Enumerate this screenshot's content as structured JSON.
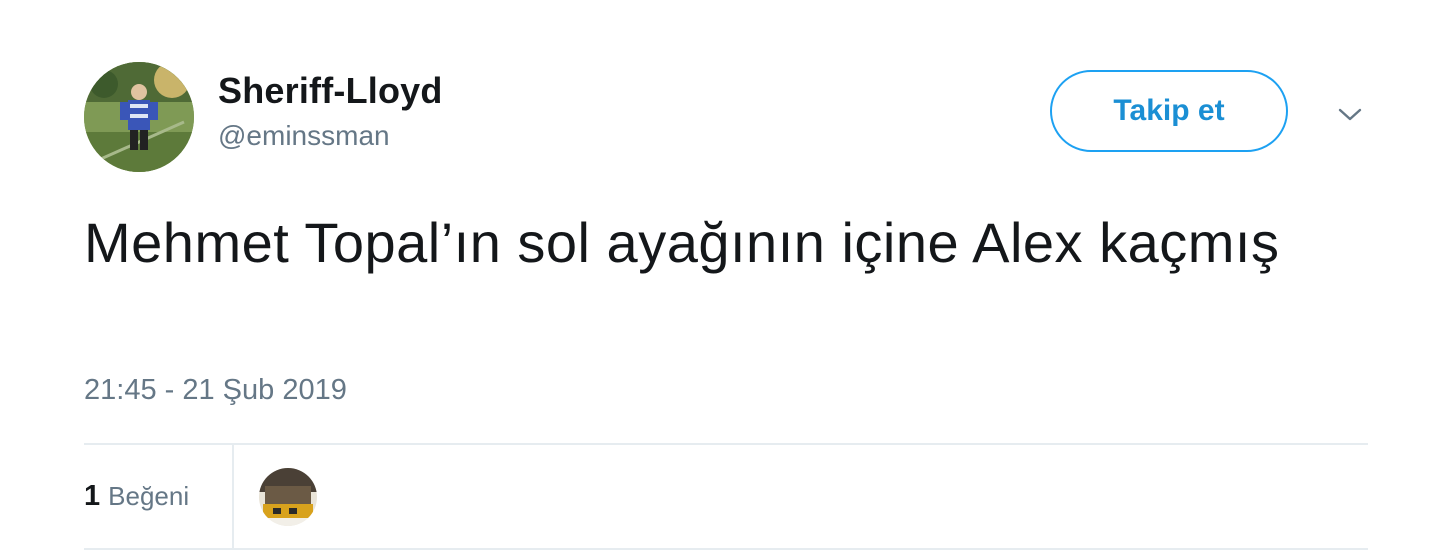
{
  "tweet": {
    "display_name": "Sheriff-Lloyd",
    "username": "@eminssman",
    "follow_label": "Takip et",
    "text": "Mehmet Topal’ın sol ayağının içine Alex kaçmış",
    "timestamp": "21:45 - 21 Şub 2019",
    "likes": {
      "count": "1",
      "label": "Beğeni"
    }
  },
  "icons": {
    "caret": "chevron-down-icon",
    "avatar": "user-avatar",
    "liker": "liker-avatar"
  },
  "colors": {
    "accent": "#1da1f2",
    "secondary_text": "#657786",
    "divider": "#e6ecf0"
  }
}
